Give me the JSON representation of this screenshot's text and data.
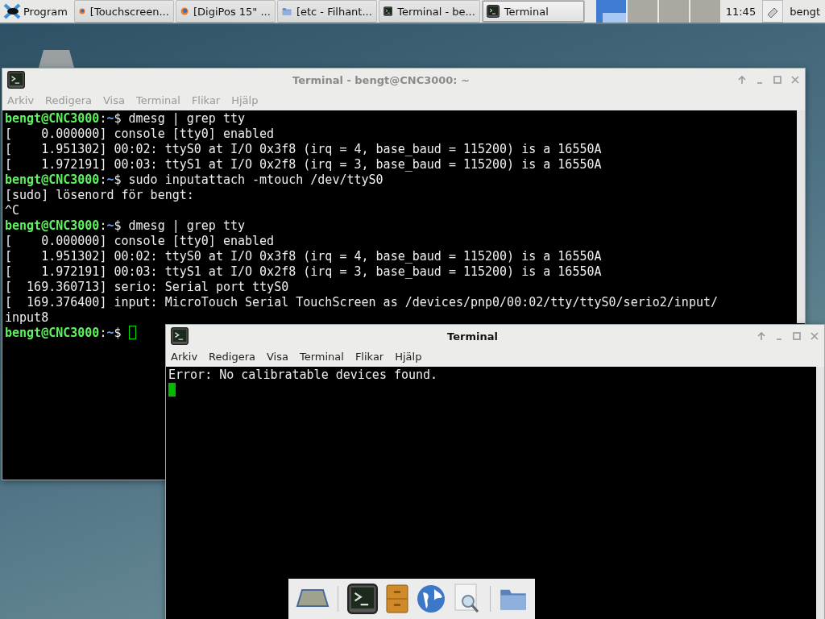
{
  "taskbar": {
    "menu_label": "Program",
    "tasks": [
      {
        "label": "[Touchscreen...",
        "kind": "browser",
        "selected": false
      },
      {
        "label": "[DigiPos 15\" ...",
        "kind": "browser",
        "selected": false
      },
      {
        "label": "[etc - Filhant...",
        "kind": "folder",
        "selected": false
      },
      {
        "label": "Terminal - be...",
        "kind": "terminal",
        "selected": false
      },
      {
        "label": "Terminal",
        "kind": "terminal",
        "selected": true
      }
    ],
    "workspaces": [
      {
        "selected": true
      },
      {
        "selected": false
      },
      {
        "selected": false
      },
      {
        "selected": false
      }
    ],
    "clock": "11:45",
    "user": "bengt"
  },
  "windows": [
    {
      "title": "Terminal - bengt@CNC3000: ~",
      "active": false,
      "menu": [
        "Arkiv",
        "Redigera",
        "Visa",
        "Terminal",
        "Flikar",
        "Hjälp"
      ],
      "lines": [
        {
          "kind": "prompt",
          "prompt": "bengt@CNC3000",
          "separator": ":",
          "path": "~",
          "text": "$ dmesg | grep tty"
        },
        {
          "kind": "output",
          "text": "[    0.000000] console [tty0] enabled"
        },
        {
          "kind": "output",
          "text": "[    1.951302] 00:02: ttyS0 at I/O 0x3f8 (irq = 4, base_baud = 115200) is a 16550A"
        },
        {
          "kind": "output",
          "text": "[    1.972191] 00:03: ttyS1 at I/O 0x2f8 (irq = 3, base_baud = 115200) is a 16550A"
        },
        {
          "kind": "prompt",
          "prompt": "bengt@CNC3000",
          "separator": ":",
          "path": "~",
          "text": "$ sudo inputattach -mtouch /dev/ttyS0"
        },
        {
          "kind": "output",
          "text": "[sudo] lösenord för bengt:"
        },
        {
          "kind": "output",
          "text": "^C"
        },
        {
          "kind": "prompt",
          "prompt": "bengt@CNC3000",
          "separator": ":",
          "path": "~",
          "text": "$ dmesg | grep tty"
        },
        {
          "kind": "output",
          "text": "[    0.000000] console [tty0] enabled"
        },
        {
          "kind": "output",
          "text": "[    1.951302] 00:02: ttyS0 at I/O 0x3f8 (irq = 4, base_baud = 115200) is a 16550A"
        },
        {
          "kind": "output",
          "text": "[    1.972191] 00:03: ttyS1 at I/O 0x2f8 (irq = 3, base_baud = 115200) is a 16550A"
        },
        {
          "kind": "output",
          "text": "[  169.360713] serio: Serial port ttyS0"
        },
        {
          "kind": "output",
          "text": "[  169.376400] input: MicroTouch Serial TouchScreen as /devices/pnp0/00:02/tty/ttyS0/serio2/input/"
        },
        {
          "kind": "output",
          "text": "input8"
        },
        {
          "kind": "prompt",
          "prompt": "bengt@CNC3000",
          "separator": ":",
          "path": "~",
          "text": "$ ",
          "cursor": true
        }
      ]
    },
    {
      "title": "Terminal",
      "active": true,
      "menu": [
        "Arkiv",
        "Redigera",
        "Visa",
        "Terminal",
        "Flikar",
        "Hjälp"
      ],
      "lines": [
        {
          "kind": "output",
          "text": "Error: No calibratable devices found."
        },
        {
          "kind": "output",
          "cursor": true
        }
      ]
    }
  ]
}
